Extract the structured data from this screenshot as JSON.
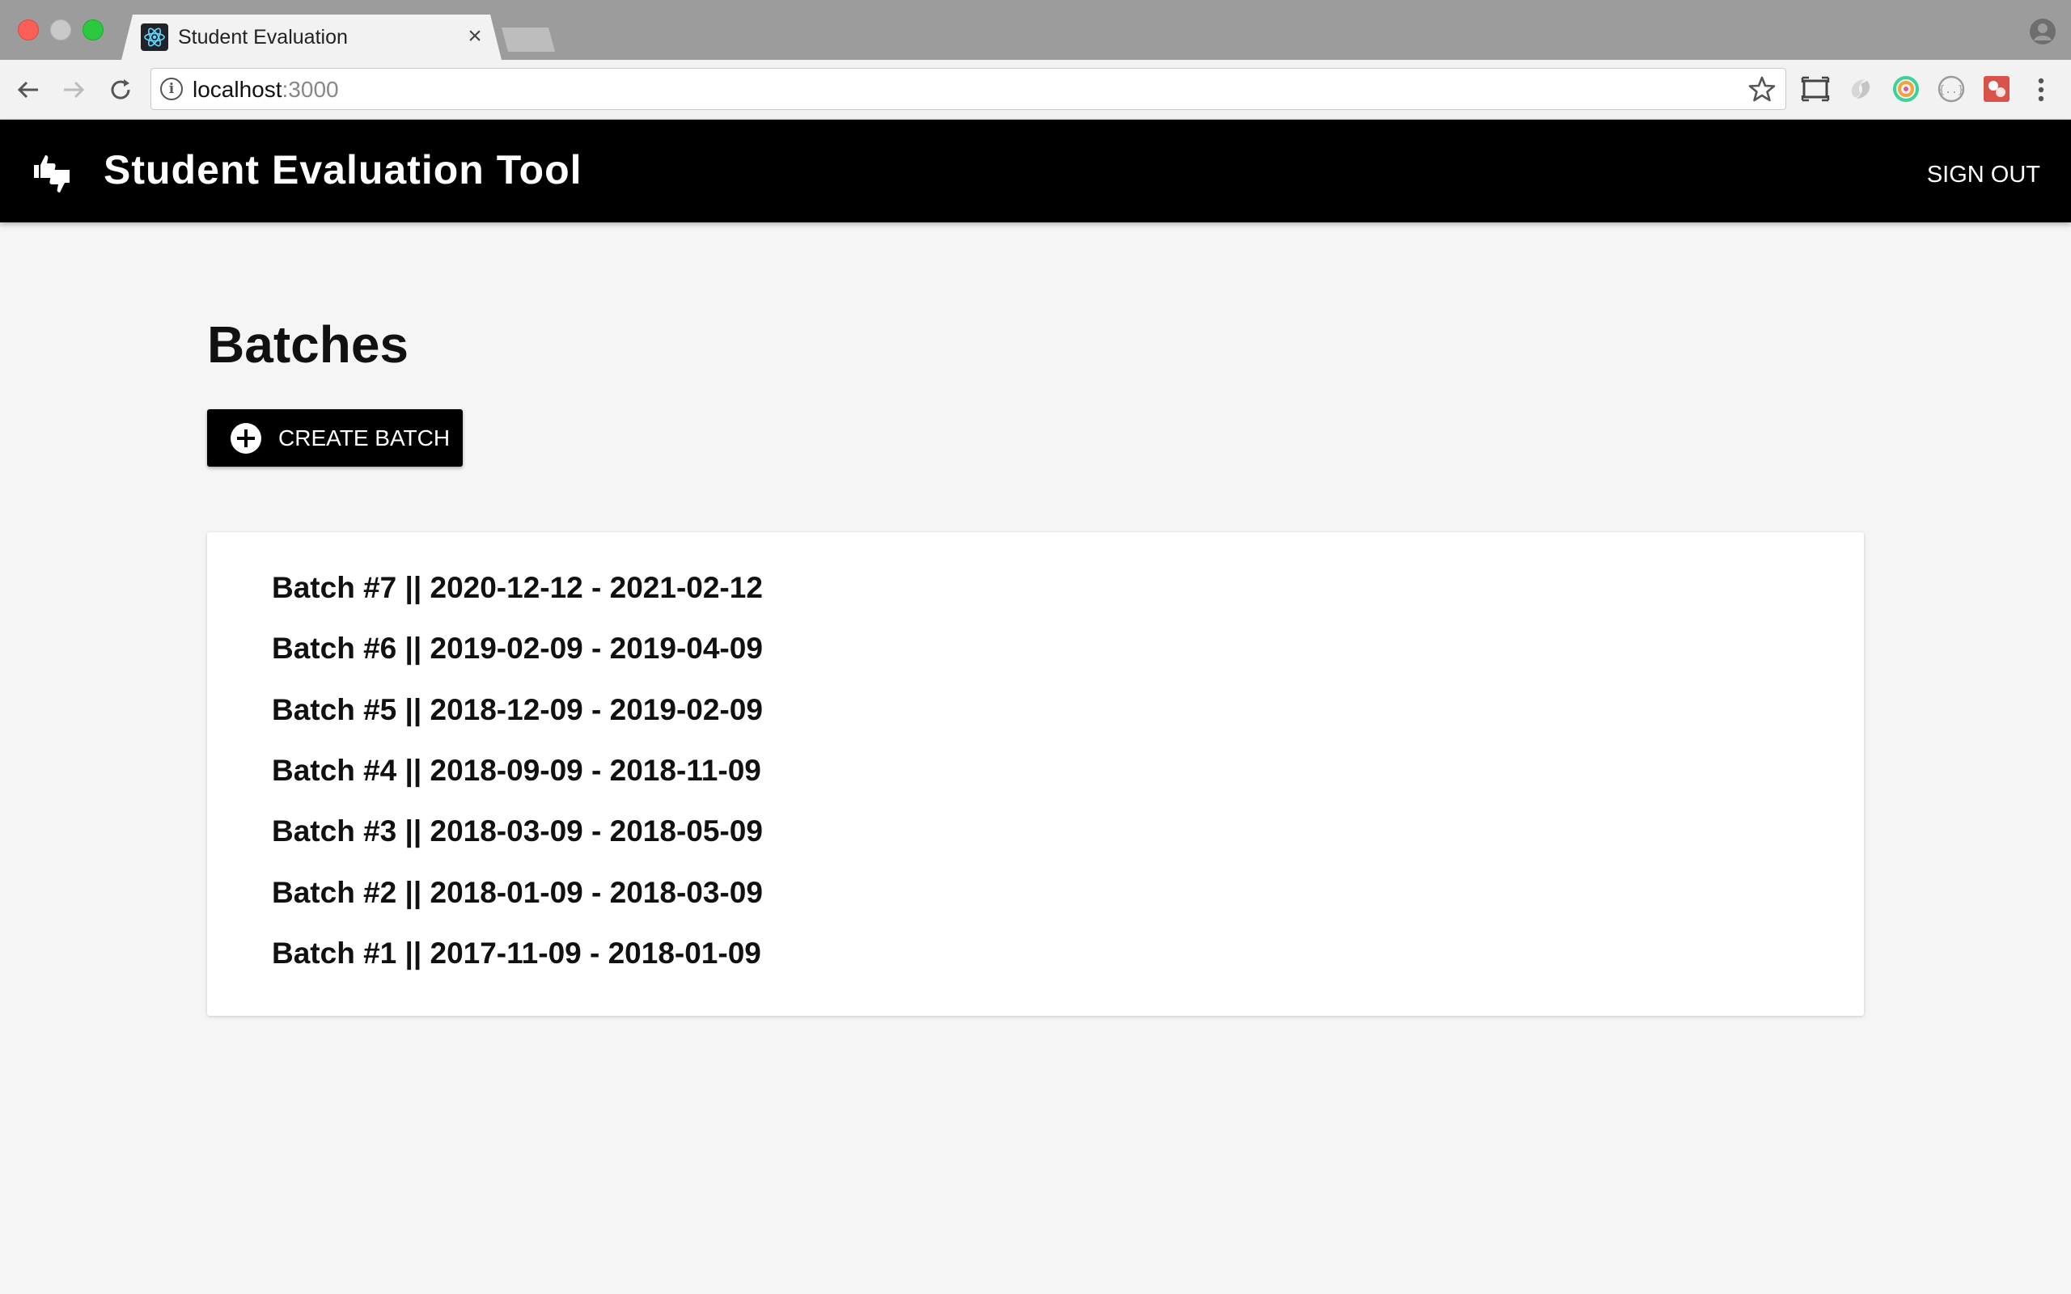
{
  "browser": {
    "tab_title": "Student Evaluation",
    "close_glyph": "×",
    "url_host": "localhost",
    "url_port": ":3000"
  },
  "app": {
    "title": "Student Evaluation Tool",
    "sign_out": "SIGN OUT"
  },
  "main": {
    "heading": "Batches",
    "create_button": "CREATE BATCH",
    "batches": [
      "Batch #7 || 2020-12-12 - 2021-02-12",
      "Batch #6 || 2019-02-09 - 2019-04-09",
      "Batch #5 || 2018-12-09 - 2019-02-09",
      "Batch #4 || 2018-09-09 - 2018-11-09",
      "Batch #3 || 2018-03-09 - 2018-05-09",
      "Batch #2 || 2018-01-09 - 2018-03-09",
      "Batch #1 || 2017-11-09 - 2018-01-09"
    ]
  },
  "icons": {
    "favicon": "react-icon",
    "logo": "thumbs-up-down-icon",
    "create": "plus-circle-icon"
  },
  "colors": {
    "appbar": "#000000",
    "background": "#f5f5f5",
    "card": "#ffffff",
    "react_blue": "#61dafb"
  }
}
